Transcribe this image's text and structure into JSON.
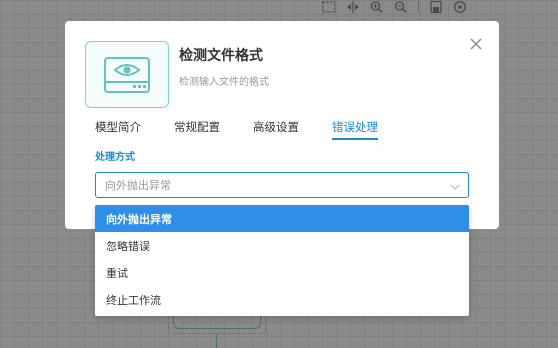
{
  "toolbar": {
    "icons": [
      "selection-icon",
      "fit-width-icon",
      "zoom-in-icon",
      "zoom-out-icon",
      "save-icon",
      "run-icon"
    ]
  },
  "modal": {
    "title": "检测文件格式",
    "subtitle": "检测输入文件的格式",
    "icon": "monitor-eye-icon",
    "tabs": [
      {
        "label": "模型简介"
      },
      {
        "label": "常规配置"
      },
      {
        "label": "高级设置"
      },
      {
        "label": "错误处理"
      }
    ],
    "active_tab": "错误处理",
    "field": {
      "label": "处理方式",
      "placeholder": "向外抛出异常"
    },
    "options": [
      {
        "label": "向外抛出异常"
      },
      {
        "label": "忽略错误"
      },
      {
        "label": "重试"
      },
      {
        "label": "终止工作流"
      }
    ]
  },
  "colors": {
    "accent": "#1a8bd6",
    "option_highlight": "#2f8fe8",
    "icon_teal": "#7fd3cf",
    "overlay": "#8a8a8a"
  }
}
